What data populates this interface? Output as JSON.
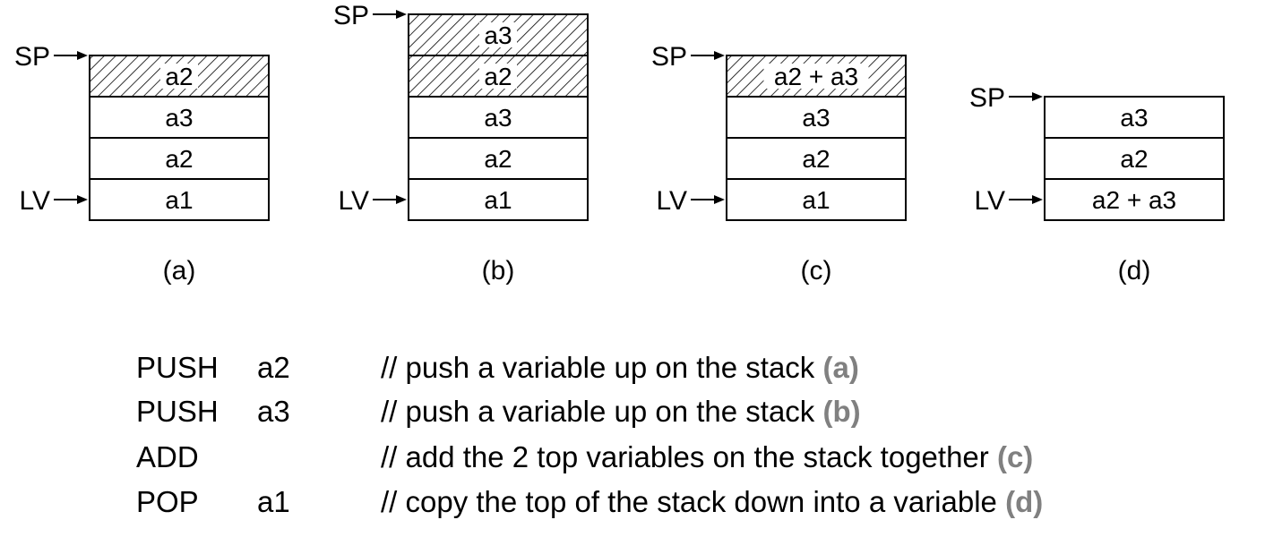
{
  "stacks": [
    {
      "caption": "(a)",
      "cells": [
        {
          "label": "a2",
          "hatched": true
        },
        {
          "label": "a3",
          "hatched": false
        },
        {
          "label": "a2",
          "hatched": false
        },
        {
          "label": "a1",
          "hatched": false
        }
      ],
      "sp_label": "SP",
      "lv_label": "LV"
    },
    {
      "caption": "(b)",
      "cells": [
        {
          "label": "a3",
          "hatched": true
        },
        {
          "label": "a2",
          "hatched": true
        },
        {
          "label": "a3",
          "hatched": false
        },
        {
          "label": "a2",
          "hatched": false
        },
        {
          "label": "a1",
          "hatched": false
        }
      ],
      "sp_label": "SP",
      "lv_label": "LV"
    },
    {
      "caption": "(c)",
      "cells": [
        {
          "label": "a2 + a3",
          "hatched": true
        },
        {
          "label": "a3",
          "hatched": false
        },
        {
          "label": "a2",
          "hatched": false
        },
        {
          "label": "a1",
          "hatched": false
        }
      ],
      "sp_label": "SP",
      "lv_label": "LV"
    },
    {
      "caption": "(d)",
      "cells": [
        {
          "label": "a3",
          "hatched": false
        },
        {
          "label": "a2",
          "hatched": false
        },
        {
          "label": "a2 + a3",
          "hatched": false
        }
      ],
      "sp_label": "SP",
      "lv_label": "LV"
    }
  ],
  "code": [
    {
      "op": "PUSH",
      "arg": "a2",
      "comment": "// push a variable up on the stack",
      "ref": "(a)"
    },
    {
      "op": "PUSH",
      "arg": "a3",
      "comment": "// push a variable up on the stack",
      "ref": "(b)"
    },
    {
      "op": "ADD",
      "arg": "",
      "comment": "// add the 2 top variables on the stack together",
      "ref": "(c)"
    },
    {
      "op": "POP",
      "arg": "a1",
      "comment": "// copy the top of the stack down into a variable",
      "ref": "(d)"
    }
  ],
  "colors": {
    "reference": "#808080",
    "line": "#000000"
  }
}
